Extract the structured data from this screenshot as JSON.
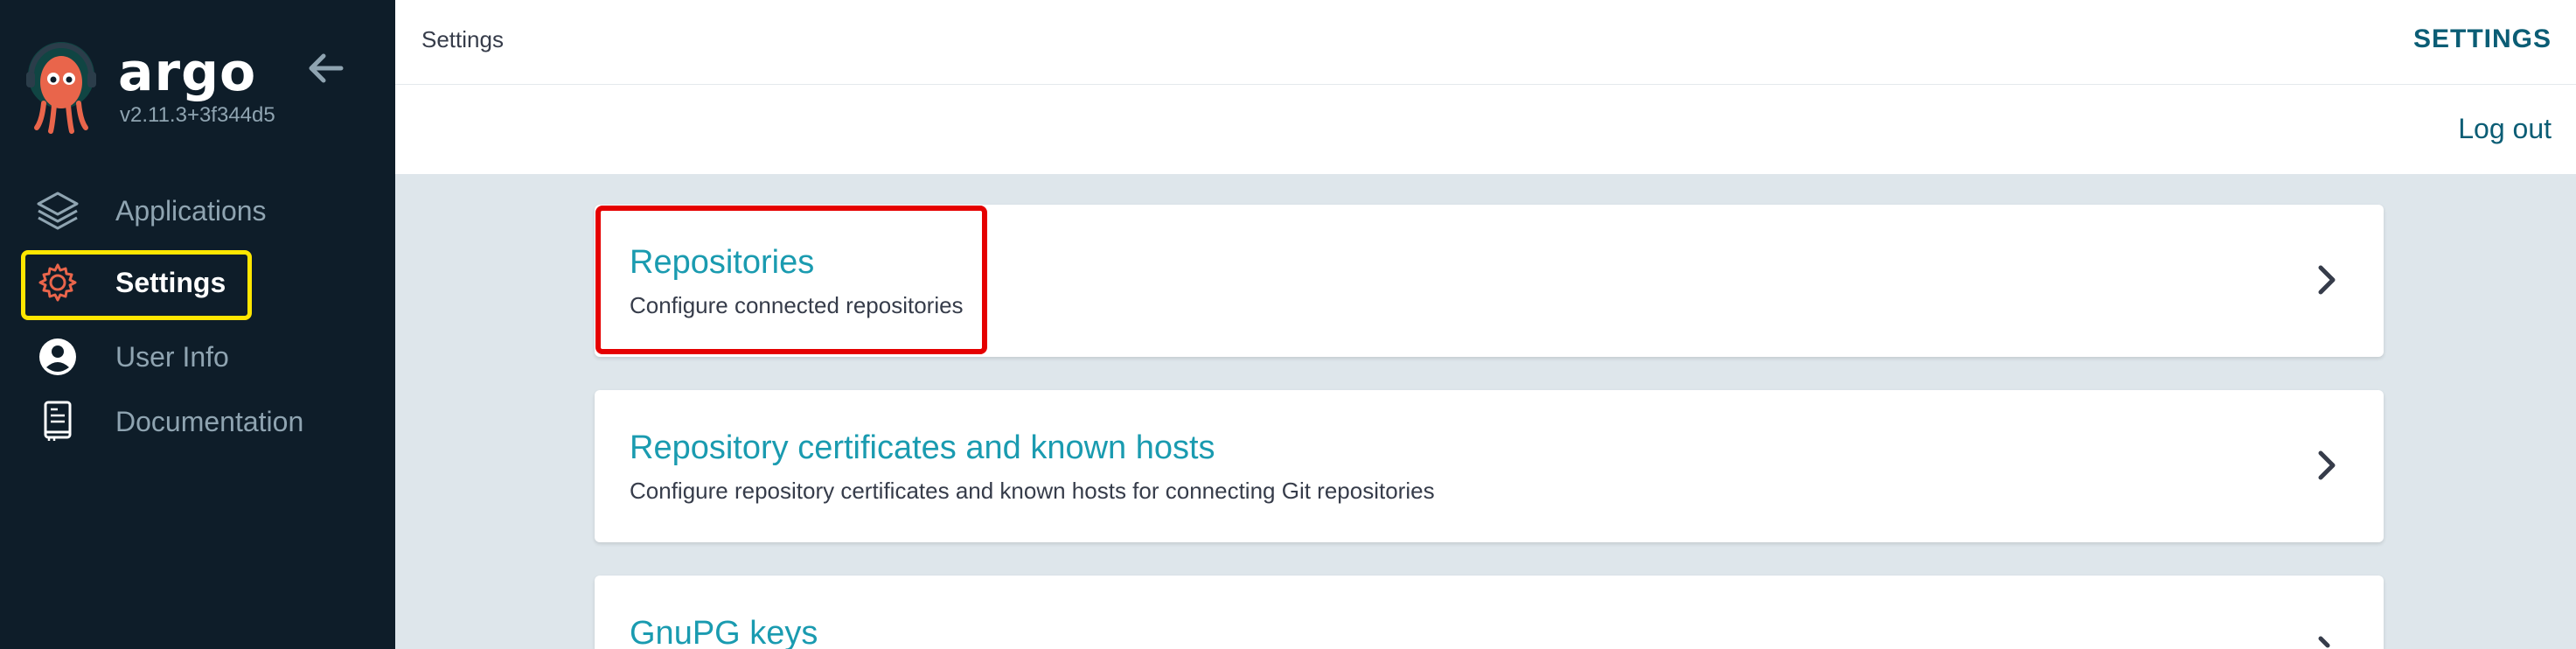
{
  "sidebar": {
    "brand_name": "argo",
    "version": "v2.11.3+3f344d5",
    "items": [
      {
        "label": "Applications",
        "icon": "layers-icon",
        "active": false
      },
      {
        "label": "Settings",
        "icon": "gear-icon",
        "active": true
      },
      {
        "label": "User Info",
        "icon": "user-circle-icon",
        "active": false
      },
      {
        "label": "Documentation",
        "icon": "book-icon",
        "active": false
      }
    ]
  },
  "header": {
    "breadcrumb": "Settings",
    "page_title": "SETTINGS"
  },
  "toolbar": {
    "logout_label": "Log out"
  },
  "settings_cards": [
    {
      "title": "Repositories",
      "description": "Configure connected repositories"
    },
    {
      "title": "Repository certificates and known hosts",
      "description": "Configure repository certificates and known hosts for connecting Git repositories"
    },
    {
      "title": "GnuPG keys",
      "description": ""
    }
  ],
  "colors": {
    "sidebar_bg": "#0e1d29",
    "accent_teal": "#1a9bb0",
    "highlight_yellow": "#ffe600",
    "highlight_red": "#e50000",
    "brand_orange": "#e9654b"
  }
}
